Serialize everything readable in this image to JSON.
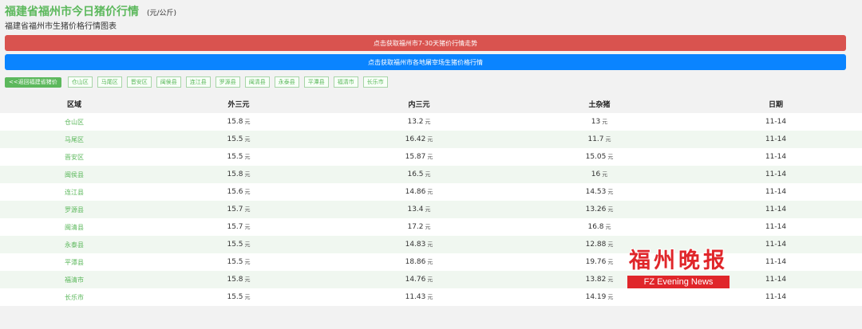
{
  "header": {
    "title": "福建省福州市今日猪价行情",
    "unit": "(元/公斤)",
    "subtitle": "福建省福州市生猪价格行情图表"
  },
  "buttons": {
    "trend": "点击获取福州市7-30天猪价行情走势",
    "markets": "点击获取福州市各地屠宰场生猪价格行情"
  },
  "nav": {
    "back": "<<返回福建省猪价",
    "regions": [
      "仓山区",
      "马尾区",
      "晋安区",
      "闽侯县",
      "连江县",
      "罗源县",
      "闽清县",
      "永泰县",
      "平潭县",
      "福清市",
      "长乐市"
    ]
  },
  "table": {
    "headers": [
      "区域",
      "外三元",
      "内三元",
      "土杂猪",
      "日期"
    ],
    "unit_suffix": "元",
    "rows": [
      {
        "area": "仓山区",
        "waisanyuan": "15.8",
        "neisanyuan": "13.2",
        "tuzazhu": "13",
        "date": "11-14"
      },
      {
        "area": "马尾区",
        "waisanyuan": "15.5",
        "neisanyuan": "16.42",
        "tuzazhu": "11.7",
        "date": "11-14"
      },
      {
        "area": "晋安区",
        "waisanyuan": "15.5",
        "neisanyuan": "15.87",
        "tuzazhu": "15.05",
        "date": "11-14"
      },
      {
        "area": "闽侯县",
        "waisanyuan": "15.8",
        "neisanyuan": "16.5",
        "tuzazhu": "16",
        "date": "11-14"
      },
      {
        "area": "连江县",
        "waisanyuan": "15.6",
        "neisanyuan": "14.86",
        "tuzazhu": "14.53",
        "date": "11-14"
      },
      {
        "area": "罗源县",
        "waisanyuan": "15.7",
        "neisanyuan": "13.4",
        "tuzazhu": "13.26",
        "date": "11-14"
      },
      {
        "area": "闽清县",
        "waisanyuan": "15.7",
        "neisanyuan": "17.2",
        "tuzazhu": "16.8",
        "date": "11-14"
      },
      {
        "area": "永泰县",
        "waisanyuan": "15.5",
        "neisanyuan": "14.83",
        "tuzazhu": "12.88",
        "date": "11-14"
      },
      {
        "area": "平潭县",
        "waisanyuan": "15.5",
        "neisanyuan": "18.86",
        "tuzazhu": "19.76",
        "date": "11-14"
      },
      {
        "area": "福清市",
        "waisanyuan": "15.8",
        "neisanyuan": "14.76",
        "tuzazhu": "13.82",
        "date": "11-14"
      },
      {
        "area": "长乐市",
        "waisanyuan": "15.5",
        "neisanyuan": "11.43",
        "tuzazhu": "14.19",
        "date": "11-14"
      }
    ]
  },
  "watermark": {
    "cn": "福州晚报",
    "en": "FZ Evening News"
  },
  "colors": {
    "green": "#5cb85c",
    "red_button": "#d9534f",
    "blue_button": "#0a84ff",
    "watermark_red": "#e0262a"
  }
}
